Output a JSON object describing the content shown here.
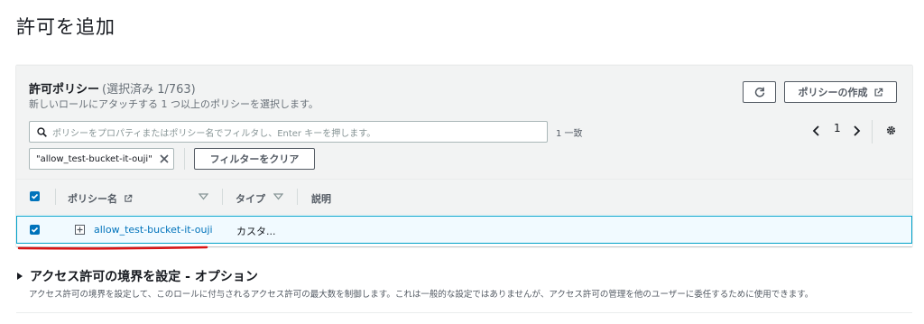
{
  "page_title": "許可を追加",
  "panel": {
    "title": "許可ポリシー",
    "selected_count": "(選択済み 1/763)",
    "description": "新しいロールにアタッチする 1 つ以上のポリシーを選択します。",
    "create_policy_label": "ポリシーの作成",
    "search": {
      "placeholder": "ポリシーをプロパティまたはポリシー名でフィルタし、Enter キーを押します。"
    },
    "match_count": "1 一致",
    "pagination": {
      "current_page": "1"
    },
    "filter_token": "\"allow_test-bucket-it-ouji\"",
    "clear_filters_label": "フィルターをクリア",
    "columns": {
      "name": "ポリシー名",
      "type": "タイプ",
      "description": "説明"
    },
    "rows": [
      {
        "name": "allow_test-bucket-it-ouji",
        "type": "カスタ...",
        "description": "",
        "selected": true
      }
    ]
  },
  "boundary_section": {
    "title": "アクセス許可の境界を設定 - オプション",
    "description": "アクセス許可の境界を設定して、このロールに付与されるアクセス許可の最大数を制御します。これは一般的な設定ではありませんが、アクセス許可の管理を他のユーザーに委任するために使用できます。"
  },
  "colors": {
    "link": "#0073bb",
    "checkbox": "#0073bb",
    "annotation_underline": "#d91515",
    "selected_row_border": "#00a1c9"
  }
}
